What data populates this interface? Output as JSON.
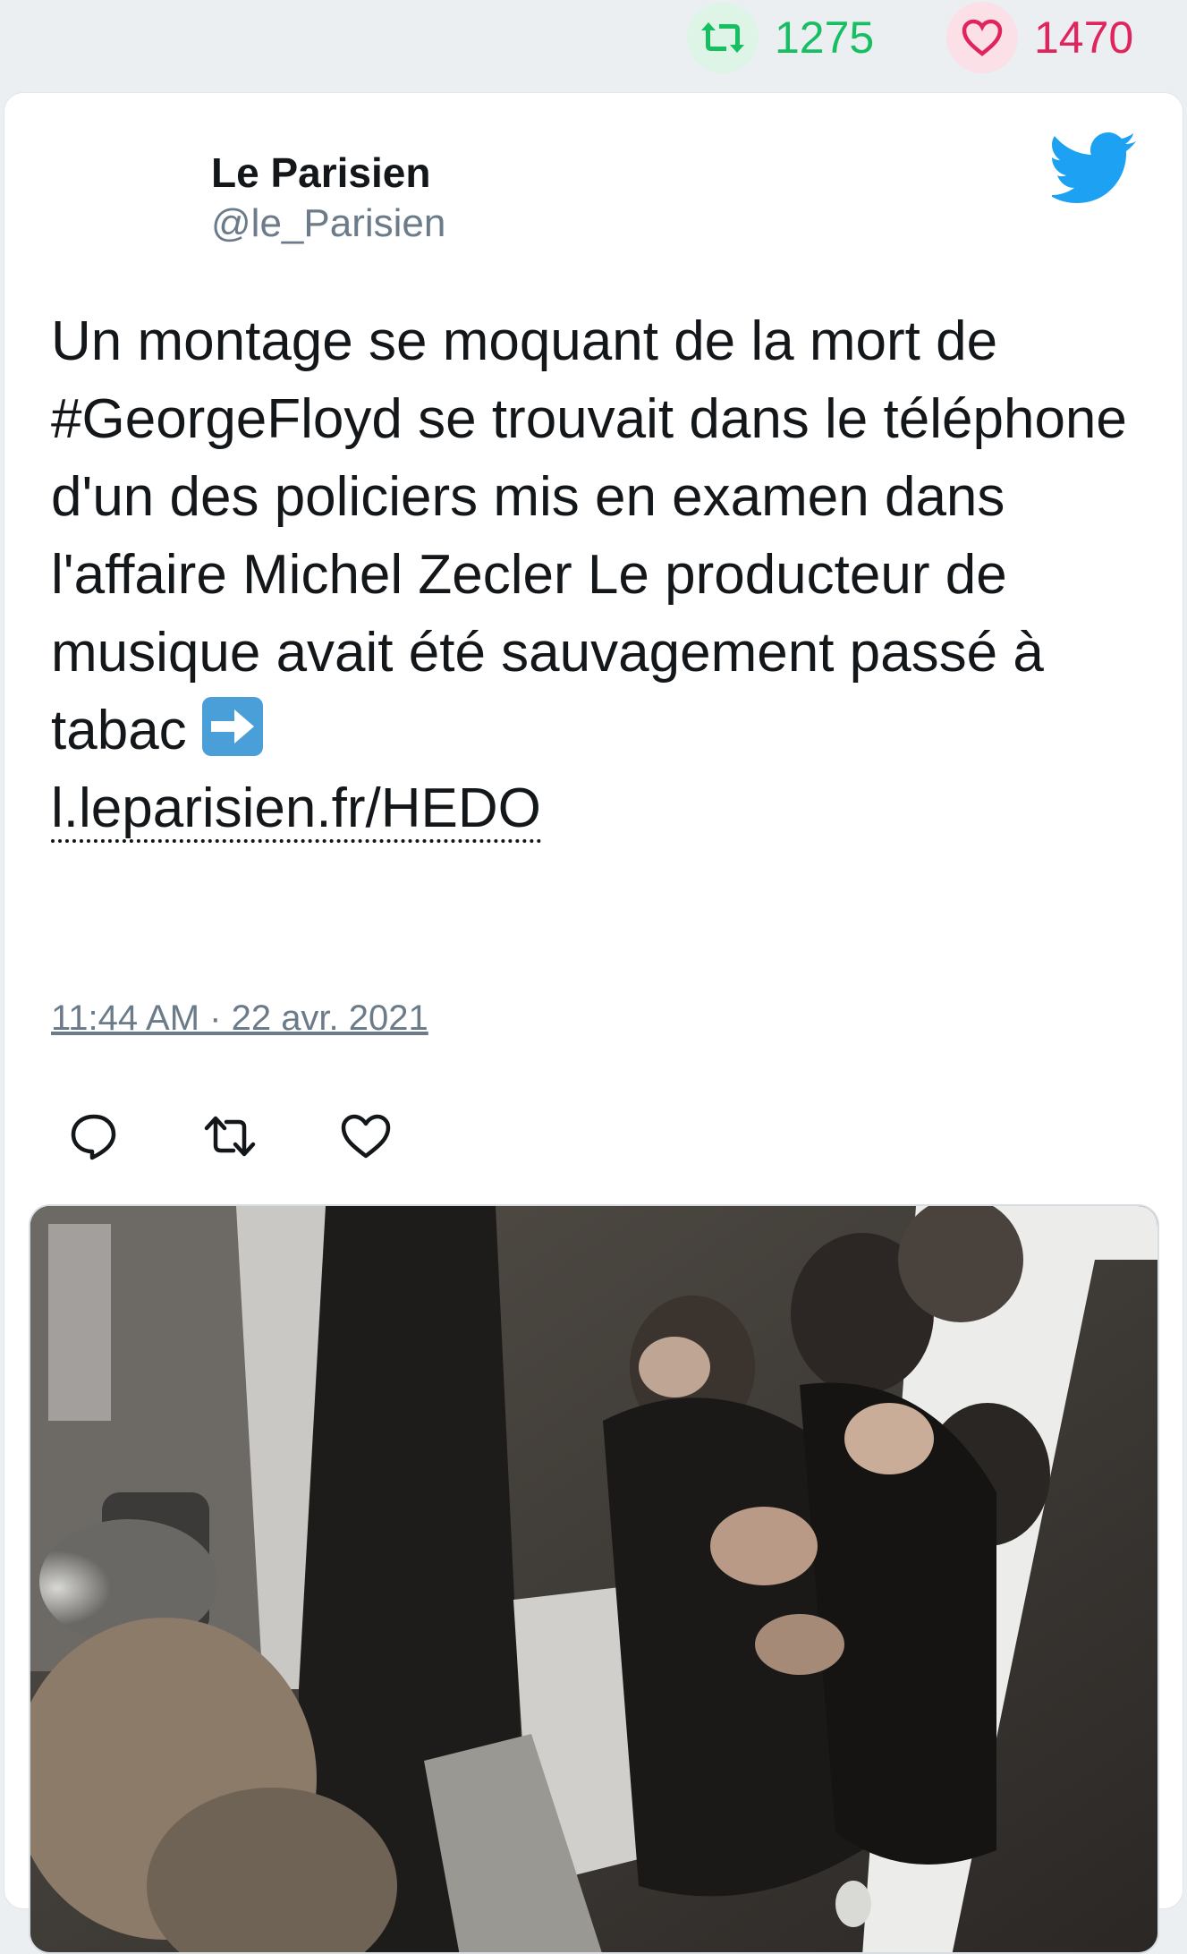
{
  "stats": {
    "retweets": "1275",
    "likes": "1470",
    "retweet_color": "#17bf63",
    "like_color": "#e0245e"
  },
  "tweet": {
    "author_name": "Le Parisien",
    "author_handle": "@le_Parisien",
    "text_before_arrow": "Un montage se moquant de la mort de #GeorgeFloyd se trouvait dans le téléphone d'un des policiers mis en examen dans l'affaire Michel Zecler Le producteur de musique avait été sauvagement passé à tabac ",
    "link_text": "l.leparisien.fr/HEDO",
    "timestamp": "11:44 AM · 22 avr. 2021",
    "icons": [
      "twitter-bird-icon",
      "reply-icon",
      "retweet-icon",
      "like-icon",
      "arrow-right-icon"
    ],
    "accent_color": "#1da1f2"
  }
}
